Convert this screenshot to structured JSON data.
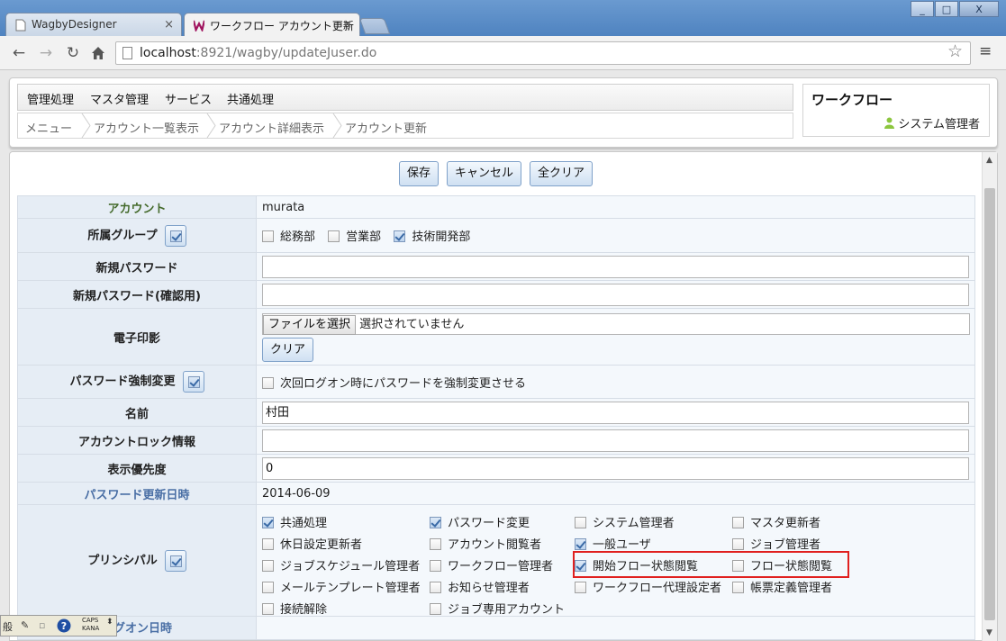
{
  "browser": {
    "tabs": [
      {
        "title": "WagbyDesigner",
        "active": false
      },
      {
        "title": "ワークフロー アカウント更新",
        "active": true
      }
    ],
    "close_glyph": "×",
    "url_host": "localhost",
    "url_rest": ":8921/wagby/updateJuser.do"
  },
  "window_controls": {
    "minimize": "_",
    "maximize": "□",
    "close": "X"
  },
  "menu": {
    "items": [
      "管理処理",
      "マスタ管理",
      "サービス",
      "共通処理"
    ]
  },
  "breadcrumb": {
    "items": [
      "メニュー",
      "アカウント一覧表示",
      "アカウント詳細表示",
      "アカウント更新"
    ]
  },
  "app": {
    "title": "ワークフロー",
    "user": "システム管理者"
  },
  "actions": {
    "save": "保存",
    "cancel": "キャンセル",
    "clear_all": "全クリア"
  },
  "form": {
    "account": {
      "label": "アカウント",
      "value": "murata"
    },
    "group": {
      "label": "所属グループ",
      "options": [
        {
          "label": "総務部",
          "checked": false
        },
        {
          "label": "営業部",
          "checked": false
        },
        {
          "label": "技術開発部",
          "checked": true
        }
      ]
    },
    "new_password": {
      "label": "新規パスワード",
      "value": ""
    },
    "new_password_confirm": {
      "label": "新規パスワード(確認用)",
      "value": ""
    },
    "seal": {
      "label": "電子印影",
      "file_button": "ファイルを選択",
      "file_status": "選択されていません",
      "clear": "クリア"
    },
    "force_change": {
      "label": "パスワード強制変更",
      "option": "次回ログオン時にパスワードを強制変更させる",
      "checked": false
    },
    "name": {
      "label": "名前",
      "value": "村田"
    },
    "lock_info": {
      "label": "アカウントロック情報",
      "value": ""
    },
    "priority": {
      "label": "表示優先度",
      "value": "0"
    },
    "pw_updated": {
      "label": "パスワード更新日時",
      "value": "2014-06-09"
    },
    "principal": {
      "label": "プリンシパル",
      "options": [
        {
          "label": "共通処理",
          "checked": true
        },
        {
          "label": "パスワード変更",
          "checked": true
        },
        {
          "label": "システム管理者",
          "checked": false
        },
        {
          "label": "マスタ更新者",
          "checked": false
        },
        {
          "label": "休日設定更新者",
          "checked": false
        },
        {
          "label": "アカウント閲覧者",
          "checked": false
        },
        {
          "label": "一般ユーザ",
          "checked": true
        },
        {
          "label": "ジョブ管理者",
          "checked": false
        },
        {
          "label": "ジョブスケジュール管理者",
          "checked": false
        },
        {
          "label": "ワークフロー管理者",
          "checked": false
        },
        {
          "label": "開始フロー状態閲覧",
          "checked": true
        },
        {
          "label": "フロー状態閲覧",
          "checked": false
        },
        {
          "label": "メールテンプレート管理者",
          "checked": false
        },
        {
          "label": "お知らせ管理者",
          "checked": false
        },
        {
          "label": "ワークフロー代理設定者",
          "checked": false
        },
        {
          "label": "帳票定義管理者",
          "checked": false
        },
        {
          "label": "接続解除",
          "checked": false
        },
        {
          "label": "ジョブ専用アカウント",
          "checked": false
        }
      ]
    },
    "last_logon": {
      "label": "ログオン日時"
    }
  },
  "ime": {
    "mode": "般",
    "caps": "CAPS",
    "kana": "KANA"
  },
  "colors": {
    "highlight": "#e0201f",
    "accent": "#4a6fa5"
  }
}
